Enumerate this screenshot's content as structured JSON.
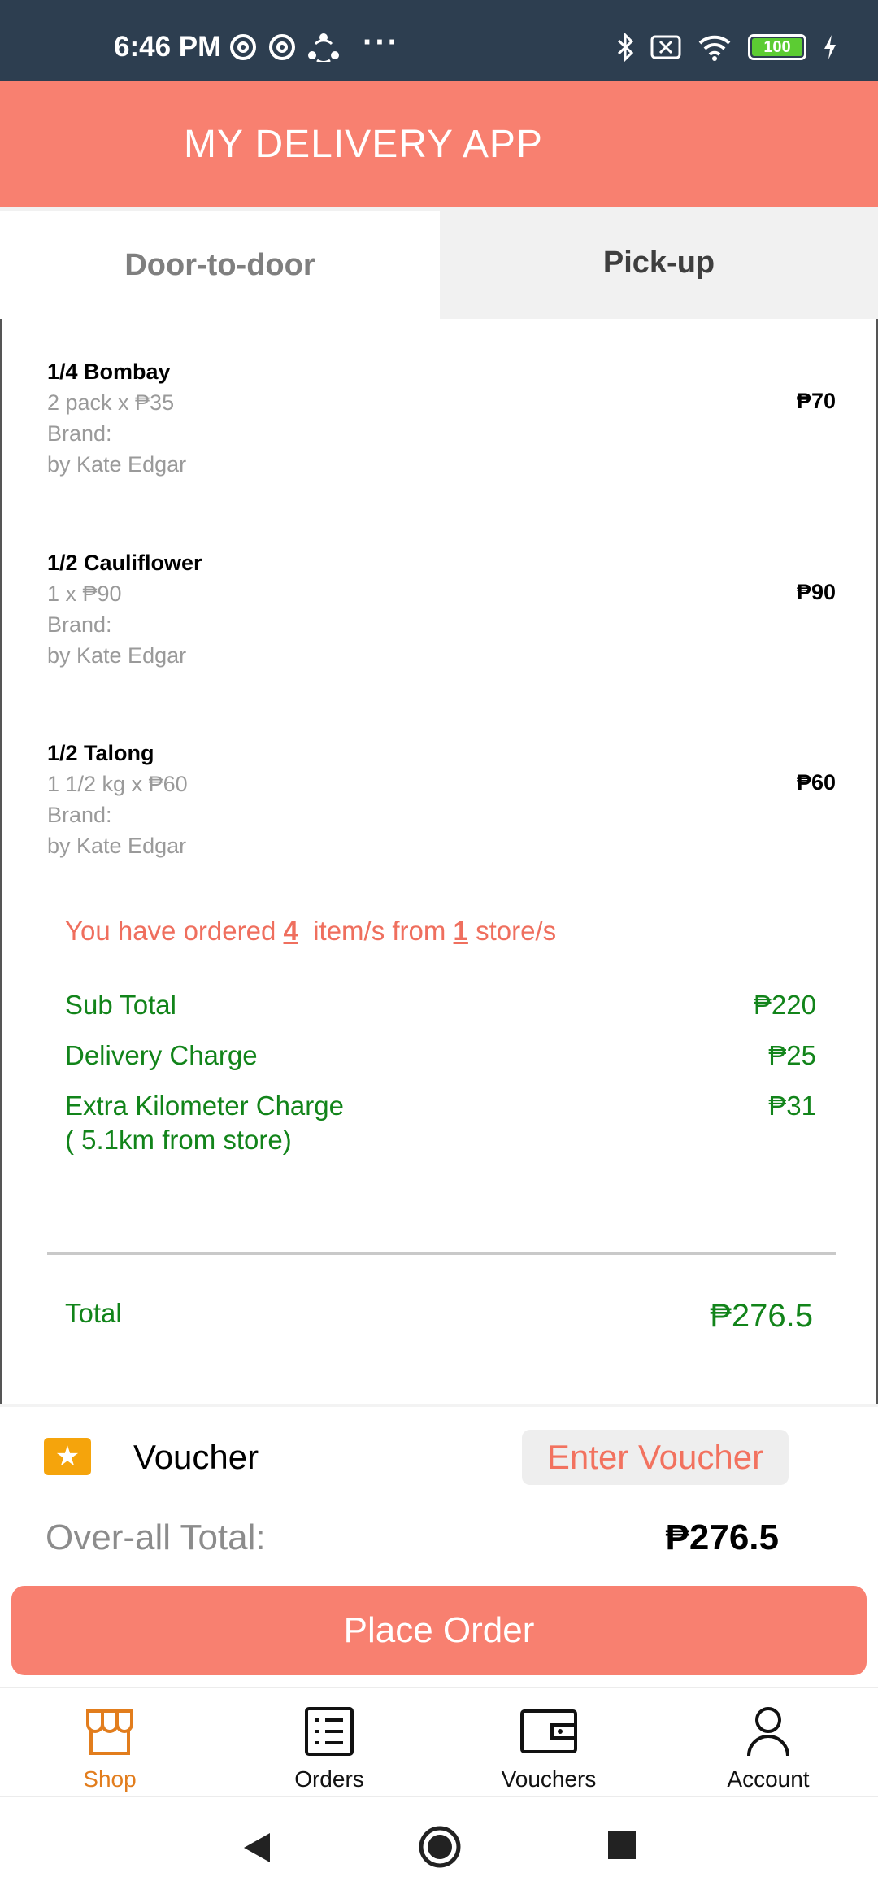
{
  "status_bar": {
    "time": "6:46 PM",
    "dots": "···",
    "battery": "100",
    "icons_left": [
      "at-icon",
      "at-icon",
      "share-nodes-icon"
    ],
    "icons_right": [
      "bluetooth-icon",
      "no-sim-icon",
      "wifi-icon",
      "battery-icon",
      "charging-icon"
    ]
  },
  "app": {
    "title": "MY DELIVERY APP",
    "accent_color": "#f88070"
  },
  "tabs": [
    {
      "label": "Door-to-door",
      "selected": true
    },
    {
      "label": "Pick-up",
      "selected": false
    }
  ],
  "items": [
    {
      "name": "1/4 Bombay",
      "qty": "2 pack x ₱35",
      "brand": "Brand:",
      "seller": "by Kate Edgar",
      "price": "₱70"
    },
    {
      "name": "1/2 Cauliflower",
      "qty": "1   x ₱90",
      "brand": "Brand:",
      "seller": "by Kate Edgar",
      "price": "₱90"
    },
    {
      "name": "1/2 Talong",
      "qty": "1 1/2 kg x ₱60",
      "brand": "Brand:",
      "seller": "by Kate Edgar",
      "price": "₱60"
    }
  ],
  "order_note": {
    "prefix": "You have ordered ",
    "item_count": "4",
    "middle": "  item/s from ",
    "store_count": "1",
    "suffix": " store/s"
  },
  "summary": {
    "subtotal_label": "Sub Total",
    "subtotal_value": "₱220",
    "delivery_label": "Delivery Charge",
    "delivery_value": "₱25",
    "extra_label": "Extra Kilometer Charge",
    "extra_sublabel": "( 5.1km from store)",
    "extra_value": "₱31",
    "total_label": "Total",
    "total_value": "₱276.5"
  },
  "voucher": {
    "label": "Voucher",
    "button": "Enter Voucher"
  },
  "overall": {
    "label": "Over-all Total:",
    "value": "₱276.5"
  },
  "place_order": "Place Order",
  "bottom_nav": [
    {
      "label": "Shop",
      "icon": "shop-icon",
      "active": true
    },
    {
      "label": "Orders",
      "icon": "list-icon",
      "active": false
    },
    {
      "label": "Vouchers",
      "icon": "wallet-icon",
      "active": false
    },
    {
      "label": "Account",
      "icon": "person-icon",
      "active": false
    }
  ]
}
